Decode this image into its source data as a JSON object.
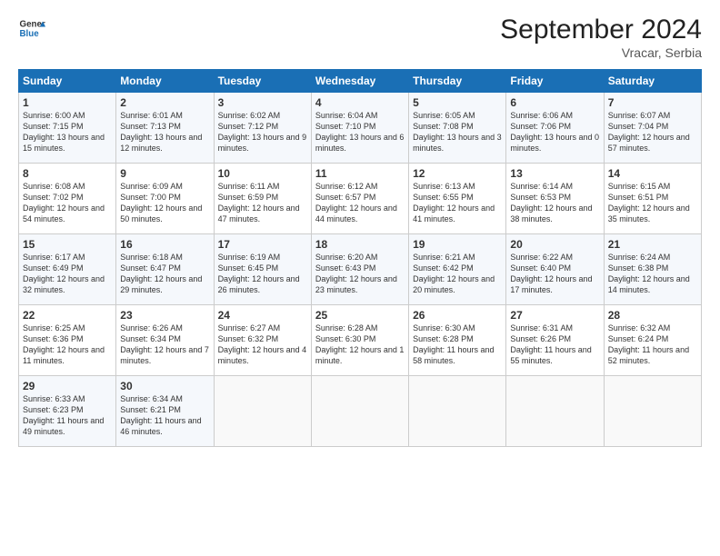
{
  "header": {
    "logo_line1": "General",
    "logo_line2": "Blue",
    "title": "September 2024",
    "subtitle": "Vracar, Serbia"
  },
  "days_of_week": [
    "Sunday",
    "Monday",
    "Tuesday",
    "Wednesday",
    "Thursday",
    "Friday",
    "Saturday"
  ],
  "weeks": [
    [
      {
        "day": "1",
        "info": "Sunrise: 6:00 AM\nSunset: 7:15 PM\nDaylight: 13 hours\nand 15 minutes."
      },
      {
        "day": "2",
        "info": "Sunrise: 6:01 AM\nSunset: 7:13 PM\nDaylight: 13 hours\nand 12 minutes."
      },
      {
        "day": "3",
        "info": "Sunrise: 6:02 AM\nSunset: 7:12 PM\nDaylight: 13 hours\nand 9 minutes."
      },
      {
        "day": "4",
        "info": "Sunrise: 6:04 AM\nSunset: 7:10 PM\nDaylight: 13 hours\nand 6 minutes."
      },
      {
        "day": "5",
        "info": "Sunrise: 6:05 AM\nSunset: 7:08 PM\nDaylight: 13 hours\nand 3 minutes."
      },
      {
        "day": "6",
        "info": "Sunrise: 6:06 AM\nSunset: 7:06 PM\nDaylight: 13 hours\nand 0 minutes."
      },
      {
        "day": "7",
        "info": "Sunrise: 6:07 AM\nSunset: 7:04 PM\nDaylight: 12 hours\nand 57 minutes."
      }
    ],
    [
      {
        "day": "8",
        "info": "Sunrise: 6:08 AM\nSunset: 7:02 PM\nDaylight: 12 hours\nand 54 minutes."
      },
      {
        "day": "9",
        "info": "Sunrise: 6:09 AM\nSunset: 7:00 PM\nDaylight: 12 hours\nand 50 minutes."
      },
      {
        "day": "10",
        "info": "Sunrise: 6:11 AM\nSunset: 6:59 PM\nDaylight: 12 hours\nand 47 minutes."
      },
      {
        "day": "11",
        "info": "Sunrise: 6:12 AM\nSunset: 6:57 PM\nDaylight: 12 hours\nand 44 minutes."
      },
      {
        "day": "12",
        "info": "Sunrise: 6:13 AM\nSunset: 6:55 PM\nDaylight: 12 hours\nand 41 minutes."
      },
      {
        "day": "13",
        "info": "Sunrise: 6:14 AM\nSunset: 6:53 PM\nDaylight: 12 hours\nand 38 minutes."
      },
      {
        "day": "14",
        "info": "Sunrise: 6:15 AM\nSunset: 6:51 PM\nDaylight: 12 hours\nand 35 minutes."
      }
    ],
    [
      {
        "day": "15",
        "info": "Sunrise: 6:17 AM\nSunset: 6:49 PM\nDaylight: 12 hours\nand 32 minutes."
      },
      {
        "day": "16",
        "info": "Sunrise: 6:18 AM\nSunset: 6:47 PM\nDaylight: 12 hours\nand 29 minutes."
      },
      {
        "day": "17",
        "info": "Sunrise: 6:19 AM\nSunset: 6:45 PM\nDaylight: 12 hours\nand 26 minutes."
      },
      {
        "day": "18",
        "info": "Sunrise: 6:20 AM\nSunset: 6:43 PM\nDaylight: 12 hours\nand 23 minutes."
      },
      {
        "day": "19",
        "info": "Sunrise: 6:21 AM\nSunset: 6:42 PM\nDaylight: 12 hours\nand 20 minutes."
      },
      {
        "day": "20",
        "info": "Sunrise: 6:22 AM\nSunset: 6:40 PM\nDaylight: 12 hours\nand 17 minutes."
      },
      {
        "day": "21",
        "info": "Sunrise: 6:24 AM\nSunset: 6:38 PM\nDaylight: 12 hours\nand 14 minutes."
      }
    ],
    [
      {
        "day": "22",
        "info": "Sunrise: 6:25 AM\nSunset: 6:36 PM\nDaylight: 12 hours\nand 11 minutes."
      },
      {
        "day": "23",
        "info": "Sunrise: 6:26 AM\nSunset: 6:34 PM\nDaylight: 12 hours\nand 7 minutes."
      },
      {
        "day": "24",
        "info": "Sunrise: 6:27 AM\nSunset: 6:32 PM\nDaylight: 12 hours\nand 4 minutes."
      },
      {
        "day": "25",
        "info": "Sunrise: 6:28 AM\nSunset: 6:30 PM\nDaylight: 12 hours\nand 1 minute."
      },
      {
        "day": "26",
        "info": "Sunrise: 6:30 AM\nSunset: 6:28 PM\nDaylight: 11 hours\nand 58 minutes."
      },
      {
        "day": "27",
        "info": "Sunrise: 6:31 AM\nSunset: 6:26 PM\nDaylight: 11 hours\nand 55 minutes."
      },
      {
        "day": "28",
        "info": "Sunrise: 6:32 AM\nSunset: 6:24 PM\nDaylight: 11 hours\nand 52 minutes."
      }
    ],
    [
      {
        "day": "29",
        "info": "Sunrise: 6:33 AM\nSunset: 6:23 PM\nDaylight: 11 hours\nand 49 minutes."
      },
      {
        "day": "30",
        "info": "Sunrise: 6:34 AM\nSunset: 6:21 PM\nDaylight: 11 hours\nand 46 minutes."
      },
      {
        "day": "",
        "info": ""
      },
      {
        "day": "",
        "info": ""
      },
      {
        "day": "",
        "info": ""
      },
      {
        "day": "",
        "info": ""
      },
      {
        "day": "",
        "info": ""
      }
    ]
  ]
}
